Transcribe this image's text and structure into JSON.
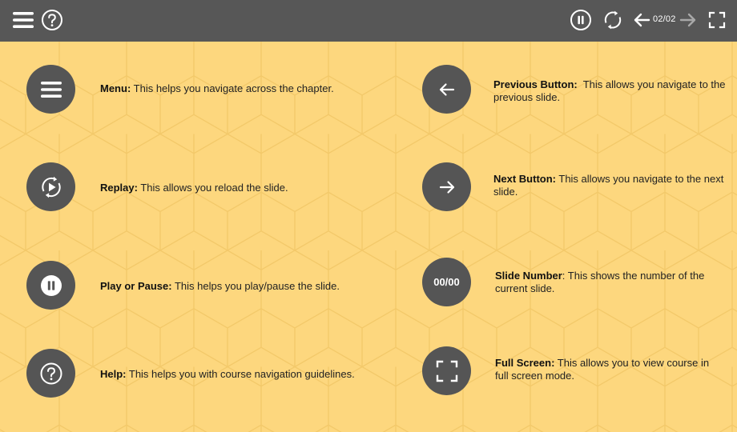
{
  "topbar": {
    "slide_counter": "02/02",
    "icons": [
      "menu-icon",
      "help-icon",
      "pause-icon",
      "replay-icon",
      "arrow-left-icon",
      "arrow-right-icon",
      "fullscreen-icon"
    ]
  },
  "colors": {
    "topbar": "#575757",
    "background": "#fdd77e",
    "circle": "#555555",
    "icon": "#ffffff"
  },
  "items": [
    {
      "icon": "menu-icon",
      "title": "Menu:",
      "text": " This helps you navigate across the chapter."
    },
    {
      "icon": "replay-icon",
      "title": "Replay:",
      "text": " This allows you reload the slide."
    },
    {
      "icon": "pause-icon",
      "title": "Play or Pause:",
      "text": " This helps you play/pause the slide."
    },
    {
      "icon": "help-icon",
      "title": "Help:",
      "text": " This helps you with course navigation guidelines."
    },
    {
      "icon": "arrow-left-icon",
      "title": "Previous Button:",
      "text": "  This allows you navigate to the previous slide."
    },
    {
      "icon": "arrow-right-icon",
      "title": "Next Button:",
      "text": " This allows you navigate to the next slide."
    },
    {
      "icon": "slide-number",
      "circle_text": "00/00",
      "title": "Slide Number",
      "text": ": This shows the number of the current slide."
    },
    {
      "icon": "fullscreen-icon",
      "title": "Full Screen:",
      "text": " This allows you to view course in full screen mode."
    }
  ]
}
